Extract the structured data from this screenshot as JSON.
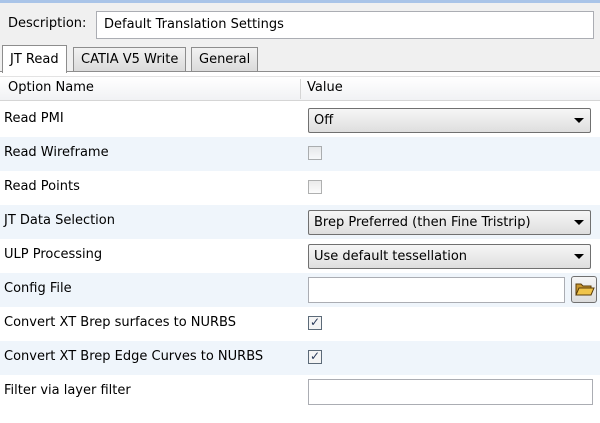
{
  "description": {
    "label": "Description:",
    "value": "Default Translation Settings"
  },
  "tabs": [
    {
      "label": "JT Read",
      "active": true
    },
    {
      "label": "CATIA V5 Write",
      "active": false
    },
    {
      "label": "General",
      "active": false
    }
  ],
  "grid": {
    "columns": [
      "Option Name",
      "Value"
    ],
    "rows": [
      {
        "name": "Read PMI",
        "control": "dropdown",
        "value": "Off"
      },
      {
        "name": "Read Wireframe",
        "control": "checkbox",
        "checked": false
      },
      {
        "name": "Read Points",
        "control": "checkbox",
        "checked": false
      },
      {
        "name": "JT Data Selection",
        "control": "dropdown",
        "value": "Brep Preferred (then Fine Tristrip)"
      },
      {
        "name": "ULP Processing",
        "control": "dropdown",
        "value": "Use default tessellation"
      },
      {
        "name": "Config File",
        "control": "file",
        "value": "",
        "button_icon": "folder-open-icon"
      },
      {
        "name": "Convert XT Brep surfaces to NURBS",
        "control": "checkbox",
        "checked": true
      },
      {
        "name": "Convert XT Brep Edge Curves to NURBS",
        "control": "checkbox",
        "checked": true
      },
      {
        "name": "Filter via layer filter",
        "control": "text",
        "value": ""
      }
    ]
  },
  "colors": {
    "alt_row": "#eff5fb",
    "accent_border": "#a9c4e8"
  }
}
